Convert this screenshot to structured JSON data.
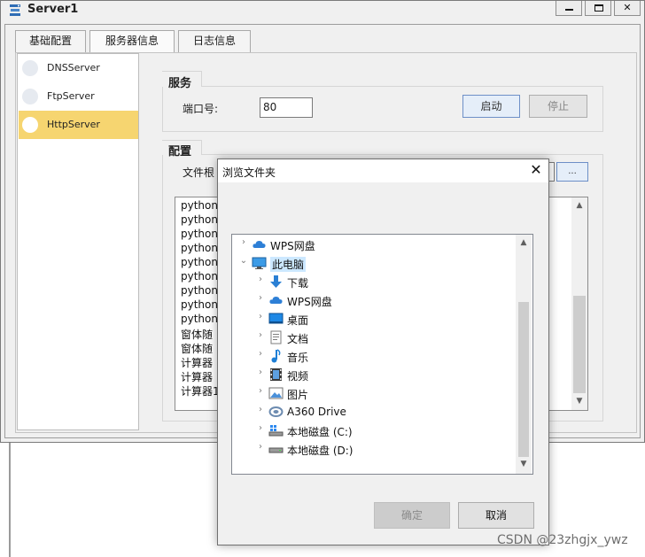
{
  "window": {
    "title": "Server1"
  },
  "tabs": [
    {
      "label": "基础配置"
    },
    {
      "label": "服务器信息"
    },
    {
      "label": "日志信息"
    }
  ],
  "sidebar": {
    "items": [
      {
        "label": "DNSServer",
        "selected": false
      },
      {
        "label": "FtpServer",
        "selected": false
      },
      {
        "label": "HttpServer",
        "selected": true
      }
    ]
  },
  "service": {
    "group_title": "服务",
    "port_label": "端口号:",
    "port_value": "80",
    "start_label": "启动",
    "stop_label": "停止"
  },
  "config": {
    "group_title": "配置",
    "doc_root_label": "文件根",
    "browse_label": "...",
    "files": [
      "python",
      "python",
      "python",
      "python",
      "python",
      "python",
      "python",
      "python",
      "python",
      "窗体随",
      "窗体随",
      "计算器",
      "计算器",
      "计算器1"
    ]
  },
  "dialog": {
    "title": "浏览文件夹",
    "tree": [
      {
        "label": "WPS网盘",
        "icon": "cloud-icon",
        "level": 0,
        "expanded": false,
        "selected": false
      },
      {
        "label": "此电脑",
        "icon": "computer-icon",
        "level": 0,
        "expanded": true,
        "selected": true
      },
      {
        "label": "下载",
        "icon": "download-icon",
        "level": 1,
        "expanded": false,
        "selected": false
      },
      {
        "label": "WPS网盘",
        "icon": "cloud-icon",
        "level": 1,
        "expanded": false,
        "selected": false
      },
      {
        "label": "桌面",
        "icon": "desktop-icon",
        "level": 1,
        "expanded": false,
        "selected": false
      },
      {
        "label": "文档",
        "icon": "document-icon",
        "level": 1,
        "expanded": false,
        "selected": false
      },
      {
        "label": "音乐",
        "icon": "music-icon",
        "level": 1,
        "expanded": false,
        "selected": false
      },
      {
        "label": "视频",
        "icon": "video-icon",
        "level": 1,
        "expanded": false,
        "selected": false
      },
      {
        "label": "图片",
        "icon": "picture-icon",
        "level": 1,
        "expanded": false,
        "selected": false
      },
      {
        "label": "A360 Drive",
        "icon": "a360-drive-icon",
        "level": 1,
        "expanded": false,
        "selected": false
      },
      {
        "label": "本地磁盘 (C:)",
        "icon": "system-drive-icon",
        "level": 1,
        "expanded": false,
        "selected": false
      },
      {
        "label": "本地磁盘 (D:)",
        "icon": "drive-icon",
        "level": 1,
        "expanded": false,
        "selected": false
      }
    ],
    "ok_label": "确定",
    "cancel_label": "取消"
  },
  "watermark": "CSDN @23zhgjx_ywz",
  "colors": {
    "selected_item": "#f6d570",
    "tree_selection": "#cce8ff",
    "accent_button_border": "#6d8fc7"
  }
}
